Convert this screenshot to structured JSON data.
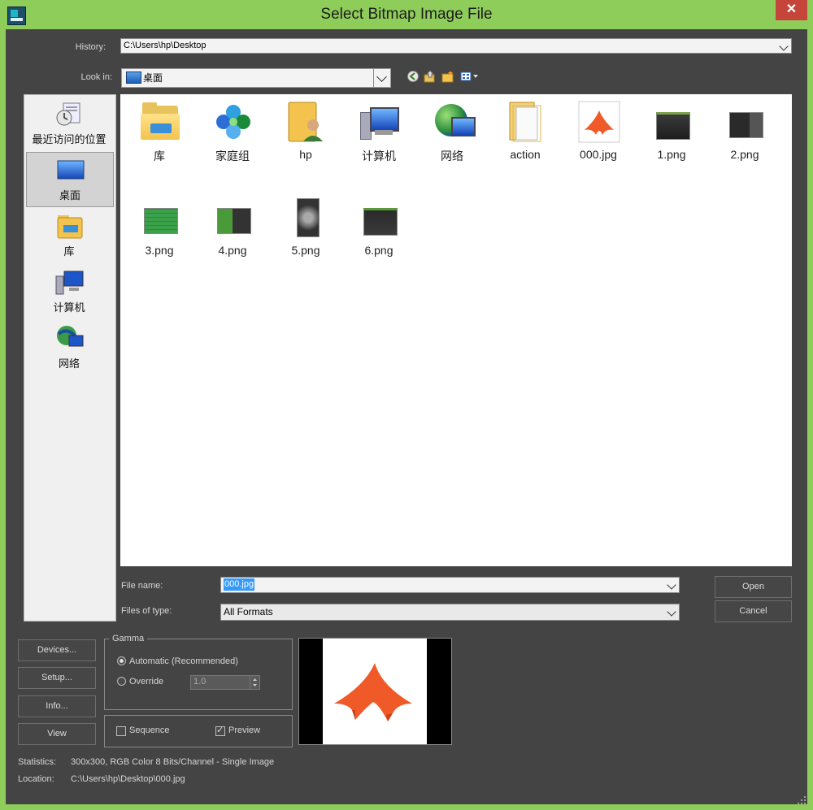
{
  "window": {
    "title": "Select Bitmap Image File",
    "close_glyph": "✕"
  },
  "history": {
    "label": "History:",
    "value": "C:\\Users\\hp\\Desktop"
  },
  "look_in": {
    "label": "Look in:",
    "value": "桌面"
  },
  "places": [
    {
      "label": "最近访问的位置",
      "icon": "recent-places-icon"
    },
    {
      "label": "桌面",
      "icon": "desktop-icon",
      "selected": true
    },
    {
      "label": "库",
      "icon": "libraries-icon"
    },
    {
      "label": "计算机",
      "icon": "computer-icon"
    },
    {
      "label": "网络",
      "icon": "network-icon"
    }
  ],
  "files": [
    {
      "name": "库",
      "icon": "libraries-folder-icon"
    },
    {
      "name": "家庭组",
      "icon": "homegroup-icon"
    },
    {
      "name": "hp",
      "icon": "user-folder-icon"
    },
    {
      "name": "计算机",
      "icon": "computer-icon"
    },
    {
      "name": "网络",
      "icon": "network-icon"
    },
    {
      "name": "action",
      "icon": "folder-icon"
    },
    {
      "name": "000.jpg",
      "icon": "image-thumbnail-icon"
    },
    {
      "name": "1.png",
      "icon": "image-thumbnail-icon"
    },
    {
      "name": "2.png",
      "icon": "image-thumbnail-icon"
    },
    {
      "name": "3.png",
      "icon": "image-thumbnail-icon"
    },
    {
      "name": "4.png",
      "icon": "image-thumbnail-icon"
    },
    {
      "name": "5.png",
      "icon": "image-thumbnail-icon"
    },
    {
      "name": "6.png",
      "icon": "image-thumbnail-icon"
    }
  ],
  "file_name": {
    "label": "File name:",
    "value": "000.jpg"
  },
  "file_type": {
    "label": "Files of type:",
    "value": "All Formats"
  },
  "buttons": {
    "open": "Open",
    "cancel": "Cancel",
    "devices": "Devices...",
    "setup": "Setup...",
    "info": "Info...",
    "view": "View"
  },
  "gamma": {
    "title": "Gamma",
    "automatic": "Automatic (Recommended)",
    "override": "Override",
    "override_value": "1.0",
    "selected": "automatic"
  },
  "options": {
    "sequence": "Sequence",
    "sequence_checked": false,
    "preview": "Preview",
    "preview_checked": true
  },
  "statistics": {
    "label": "Statistics:",
    "value": "300x300, RGB Color 8 Bits/Channel - Single Image"
  },
  "location": {
    "label": "Location:",
    "value": "C:\\Users\\hp\\Desktop\\000.jpg"
  },
  "colors": {
    "window_frame": "#8fcd5a",
    "dialog_bg": "#444444",
    "selection": "#3399ff",
    "close_button": "#c6453b"
  }
}
